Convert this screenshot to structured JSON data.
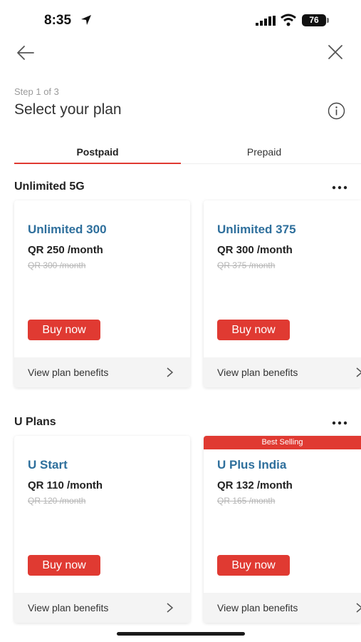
{
  "status": {
    "time": "8:35",
    "battery": "76"
  },
  "step": "Step 1 of 3",
  "title": "Select your plan",
  "tabs": [
    {
      "label": "Postpaid",
      "active": true
    },
    {
      "label": "Prepaid",
      "active": false
    }
  ],
  "sections": [
    {
      "title": "Unlimited 5G",
      "plans": [
        {
          "name": "Unlimited 300",
          "price": "QR 250 /month",
          "old_price": "QR 300 /month",
          "button": "Buy now",
          "benefits": "View plan benefits"
        },
        {
          "name": "Unlimited 375",
          "price": "QR 300 /month",
          "old_price": "QR 375 /month",
          "button": "Buy now",
          "benefits": "View plan benefits"
        }
      ]
    },
    {
      "title": "U Plans",
      "plans": [
        {
          "name": "U Start",
          "price": "QR 110 /month",
          "old_price": "QR 120 /month",
          "button": "Buy now",
          "benefits": "View plan benefits"
        },
        {
          "badge": "Best Selling",
          "name": "U Plus India",
          "price": "QR 132 /month",
          "old_price": "QR 165 /month",
          "button": "Buy now",
          "benefits": "View plan benefits"
        }
      ]
    }
  ],
  "colors": {
    "accent": "#e03a32",
    "plan_name": "#2e6f9c"
  },
  "icons": [
    "location-arrow-icon",
    "signal-icon",
    "wifi-icon",
    "back-arrow-icon",
    "close-icon",
    "info-icon",
    "more-dots-icon",
    "chevron-right-icon"
  ]
}
